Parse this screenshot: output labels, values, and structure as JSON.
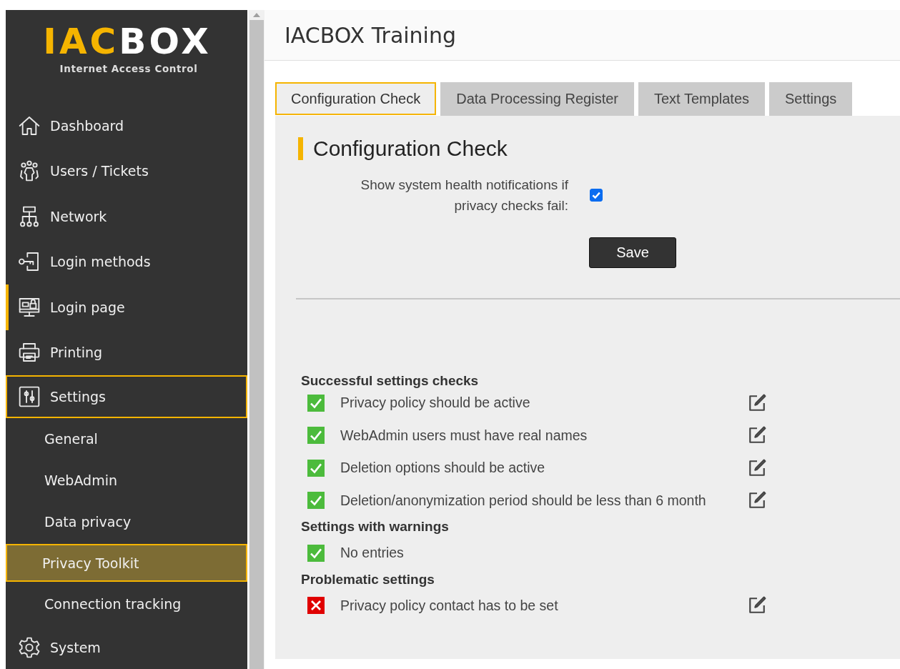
{
  "logo": {
    "accent": "IAC",
    "rest": "BOX",
    "tagline": "Internet Access Control"
  },
  "nav": [
    {
      "kind": "item",
      "label": "Dashboard",
      "selected": false,
      "expanded": false,
      "marked": false
    },
    {
      "kind": "item",
      "label": "Users / Tickets",
      "selected": false,
      "expanded": false,
      "marked": false
    },
    {
      "kind": "item",
      "label": "Network",
      "selected": false,
      "expanded": false,
      "marked": false
    },
    {
      "kind": "item",
      "label": "Login methods",
      "selected": false,
      "expanded": false,
      "marked": false
    },
    {
      "kind": "item",
      "label": "Login page",
      "selected": false,
      "expanded": false,
      "marked": true
    },
    {
      "kind": "item",
      "label": "Printing",
      "selected": false,
      "expanded": false,
      "marked": false
    },
    {
      "kind": "item",
      "label": "Settings",
      "selected": false,
      "expanded": true,
      "marked": false
    },
    {
      "kind": "subitem",
      "label": "General",
      "selected": false,
      "expanded": false,
      "marked": false
    },
    {
      "kind": "subitem",
      "label": "WebAdmin",
      "selected": false,
      "expanded": false,
      "marked": false
    },
    {
      "kind": "subitem",
      "label": "Data privacy",
      "selected": false,
      "expanded": false,
      "marked": false
    },
    {
      "kind": "subitem",
      "label": "Privacy Toolkit",
      "selected": true,
      "expanded": false,
      "marked": false
    },
    {
      "kind": "subitem",
      "label": "Connection tracking",
      "selected": false,
      "expanded": false,
      "marked": false
    },
    {
      "kind": "item",
      "label": "System",
      "selected": false,
      "expanded": false,
      "marked": false
    }
  ],
  "page_title": "IACBOX Training",
  "tabs": [
    {
      "label": "Configuration Check",
      "selected": true
    },
    {
      "label": "Data Processing Register",
      "selected": false
    },
    {
      "label": "Text Templates",
      "selected": false
    },
    {
      "label": "Settings",
      "selected": false
    }
  ],
  "panel": {
    "heading": "Configuration Check",
    "option": {
      "label": "Show system health notifications if privacy checks fail:",
      "checked": true
    },
    "save_button": "Save",
    "sections": [
      {
        "heading": "Successful settings checks",
        "rows": [
          {
            "text": "Privacy policy should be active",
            "passed": true,
            "editable": true
          },
          {
            "text": "WebAdmin users must have real names",
            "passed": true,
            "editable": true
          },
          {
            "text": "Deletion options should be active",
            "passed": true,
            "editable": true
          },
          {
            "text": "Deletion/anonymization period should be less than 6 month",
            "passed": true,
            "editable": true
          }
        ]
      },
      {
        "heading": "Settings with warnings",
        "rows": [
          {
            "text": "No entries",
            "passed": true,
            "editable": false
          }
        ]
      },
      {
        "heading": "Problematic settings",
        "rows": [
          {
            "text": "Privacy policy contact has to be set",
            "passed": false,
            "editable": true
          }
        ]
      }
    ]
  }
}
